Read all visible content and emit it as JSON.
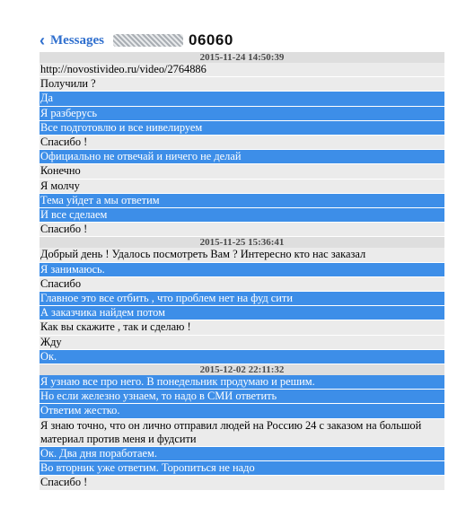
{
  "header": {
    "back_label": "Messages",
    "contact_suffix": "06060",
    "colors": {
      "link": "#2f6fce",
      "outgoing": "#3d8ee8",
      "incoming": "#ebebeb",
      "timestamp_bg": "#dedede"
    }
  },
  "thread": [
    {
      "kind": "timestamp",
      "text": "2015-11-24 14:50:39"
    },
    {
      "kind": "in",
      "text": "http://novostivideo.ru/video/2764886"
    },
    {
      "kind": "in",
      "text": "Получили ?"
    },
    {
      "kind": "out",
      "text": "Да"
    },
    {
      "kind": "out",
      "text": "Я разберусь"
    },
    {
      "kind": "out",
      "text": "Все подготовлю и все нивелируем"
    },
    {
      "kind": "in",
      "text": "Спасибо !"
    },
    {
      "kind": "out",
      "text": "Официально не отвечай и ничего не делай"
    },
    {
      "kind": "in",
      "text": "Конечно"
    },
    {
      "kind": "in",
      "text": "Я молчу"
    },
    {
      "kind": "out",
      "text": "Тема уйдет а мы ответим"
    },
    {
      "kind": "out",
      "text": "И все сделаем"
    },
    {
      "kind": "in",
      "text": "Спасибо !"
    },
    {
      "kind": "timestamp",
      "text": "2015-11-25 15:36:41"
    },
    {
      "kind": "in",
      "text": "Добрый день ! Удалось посмотреть Вам ? Интересно кто нас заказал"
    },
    {
      "kind": "out",
      "text": "Я занимаюсь."
    },
    {
      "kind": "in",
      "text": "Спасибо"
    },
    {
      "kind": "out",
      "text": "Главное это все отбить , что проблем нет на фуд сити"
    },
    {
      "kind": "out",
      "text": "А заказчика найдем потом"
    },
    {
      "kind": "in",
      "text": "Как вы скажите , так и сделаю !"
    },
    {
      "kind": "in",
      "text": "Жду"
    },
    {
      "kind": "out",
      "text": "Ок."
    },
    {
      "kind": "timestamp",
      "text": "2015-12-02 22:11:32"
    },
    {
      "kind": "out",
      "text": "Я узнаю все про него. В понедельник продумаю и решим."
    },
    {
      "kind": "out",
      "text": "Но если железно узнаем, то надо в СМИ ответить"
    },
    {
      "kind": "out",
      "text": "Ответим жестко."
    },
    {
      "kind": "in",
      "text": "Я знаю точно, что он лично отправил людей на Россию 24 с заказом на большой материал против меня и фудсити",
      "wrap": true
    },
    {
      "kind": "out",
      "text": "Ок. Два дня поработаем."
    },
    {
      "kind": "out",
      "text": "Во вторник уже ответим. Торопиться не надо"
    },
    {
      "kind": "in",
      "text": "Спасибо !"
    }
  ]
}
